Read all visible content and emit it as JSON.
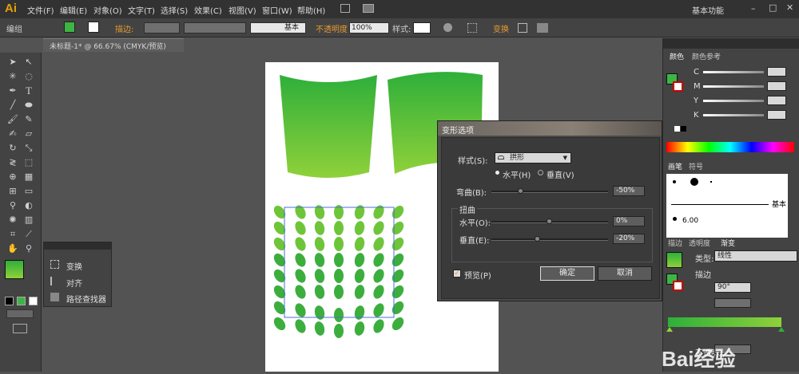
{
  "app": {
    "logo": "Ai",
    "workspace": "基本功能"
  },
  "menu": [
    "文件(F)",
    "编辑(E)",
    "对象(O)",
    "文字(T)",
    "选择(S)",
    "效果(C)",
    "视图(V)",
    "窗口(W)",
    "帮助(H)"
  ],
  "control_bar": {
    "selection": "编组",
    "stroke_label": "描边:",
    "stroke_style": "基本",
    "opacity_label": "不透明度",
    "opacity_value": "100%",
    "style_label": "样式:",
    "transform_label": "变换"
  },
  "document_tab": "未标题-1* @ 66.67% (CMYK/预览)",
  "float_panel": {
    "items": [
      "变换",
      "对齐",
      "路径查找器"
    ]
  },
  "warp_dialog": {
    "title": "变形选项",
    "style_label": "样式(S):",
    "style_value": "拱形",
    "horizontal": "水平(H)",
    "vertical": "垂直(V)",
    "bend_label": "弯曲(B):",
    "bend_value": "-50%",
    "bend_fraction": 0.25,
    "distortion_group": "扭曲",
    "dist_h_label": "水平(O):",
    "dist_h_value": "0%",
    "dist_h_fraction": 0.5,
    "dist_v_label": "垂直(E):",
    "dist_v_value": "-20%",
    "dist_v_fraction": 0.4,
    "preview": "预览(P)",
    "ok": "确定",
    "cancel": "取消"
  },
  "right_panel": {
    "color_tabs": [
      "颜色",
      "颜色参考"
    ],
    "cmyk": [
      "C",
      "M",
      "Y",
      "K"
    ],
    "brush_tabs": [
      "画笔",
      "符号"
    ],
    "brush_name": "基本",
    "brush_size": "6.00",
    "stroke_tabs": [
      "描边",
      "透明度",
      "渐变"
    ],
    "type_label": "类型:",
    "type_value": "线性",
    "stroke_label": "描边",
    "angle_value": "90°",
    "opacity_label": "不透明度"
  },
  "watermark": "Bai经验",
  "colors": {
    "gradient_start": "#2eaf3a",
    "gradient_end": "#8fd13a",
    "accent": "#e69a2e"
  }
}
